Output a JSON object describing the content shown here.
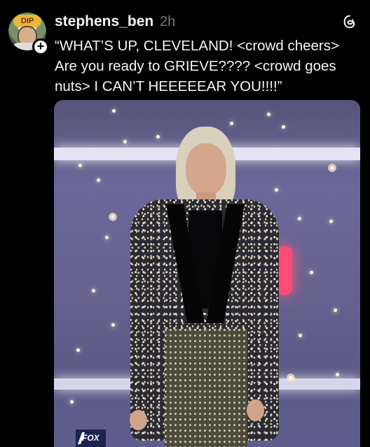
{
  "post": {
    "username": "stephens_ben",
    "time": "2h",
    "text": "“WHAT’S UP, CLEVELAND! <crowd cheers> Are you ready to GRIEVE???? <crowd goes nuts> I CAN’T HEEEEEAR YOU!!!!”",
    "avatar_badge": "DIP",
    "follow_badge": "+",
    "media_logo": "FOX"
  },
  "icons": [
    "threads-icon",
    "plus-icon"
  ]
}
